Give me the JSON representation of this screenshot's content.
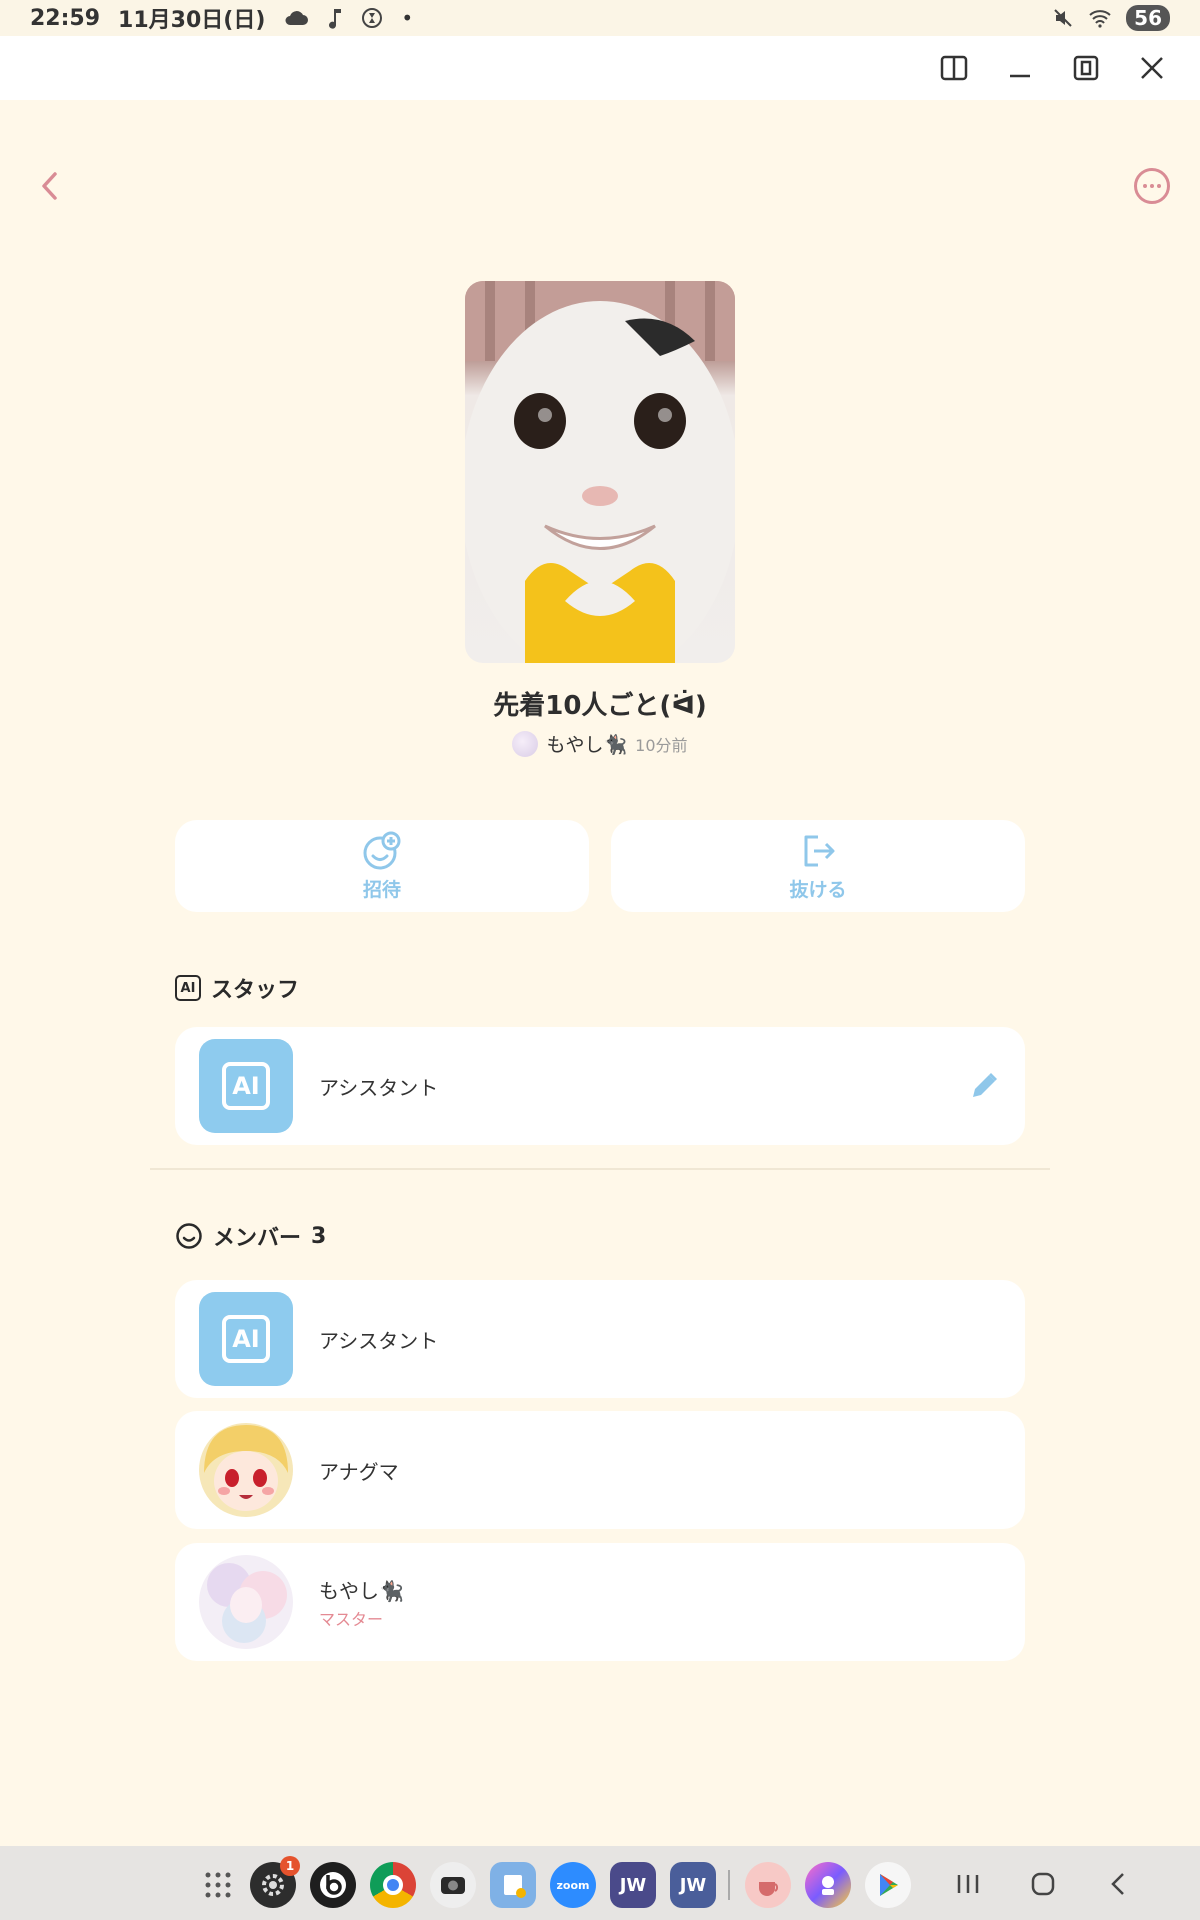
{
  "status_bar": {
    "time": "22:59",
    "date": "11月30日(日)",
    "battery": "56"
  },
  "header": {
    "back_icon": "chevron-left-icon",
    "more_icon": "more-horizontal-icon"
  },
  "group": {
    "title": "先着10人ごと(ᐛ)",
    "creator_name": "もやし🐈‍⬛",
    "time_ago": "10分前"
  },
  "actions": {
    "invite_label": "招待",
    "leave_label": "抜ける"
  },
  "staff_section": {
    "title": "スタッフ",
    "ai_badge": "AI",
    "items": [
      {
        "name": "アシスタント",
        "avatar_label": "AI"
      }
    ]
  },
  "members_section": {
    "title": "メンバー",
    "count": "3",
    "items": [
      {
        "name": "アシスタント",
        "avatar_label": "AI",
        "role": ""
      },
      {
        "name": "アナグマ",
        "role": ""
      },
      {
        "name": "もやし🐈‍⬛",
        "role": "マスター"
      }
    ]
  },
  "taskbar": {
    "settings_badge": "1",
    "zoom_label": "zoom",
    "jw_library_label": "JW",
    "jw_org_label": "JW"
  },
  "colors": {
    "background": "#fff8e9",
    "accent_blue": "#8fc7ea",
    "accent_pink": "#d98c95",
    "role_pink": "#e48a93"
  }
}
